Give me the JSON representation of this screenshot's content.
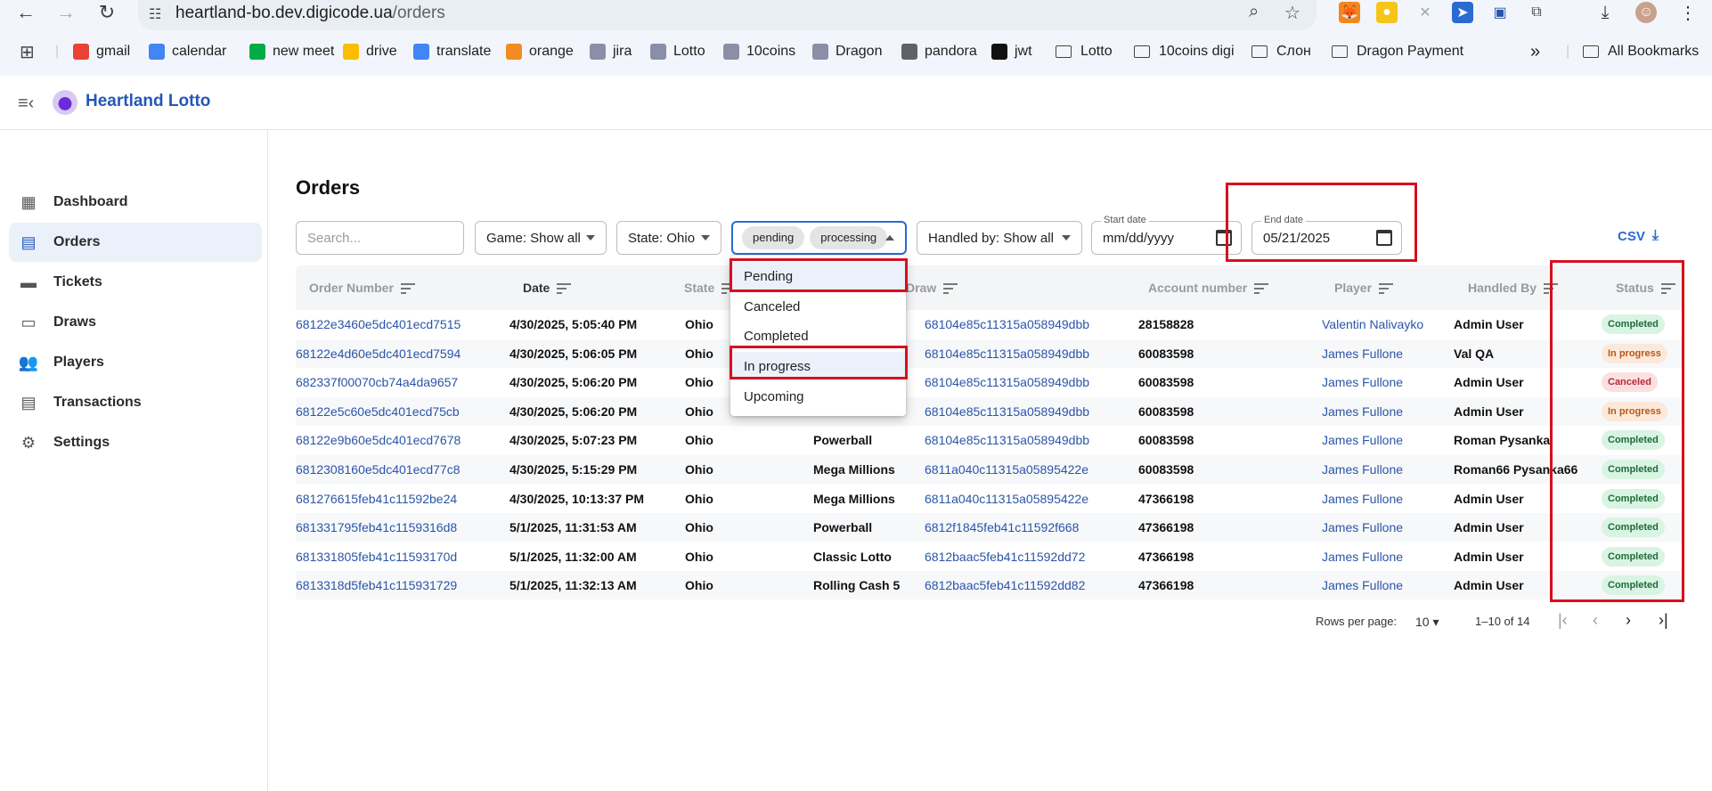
{
  "browser": {
    "url_host": "heartland-bo.dev.digicode.ua",
    "url_path": "/orders",
    "bookmarks": [
      {
        "label": "gmail",
        "icon": "gmail-icon",
        "color": "#ea4335"
      },
      {
        "label": "calendar",
        "icon": "calendar-icon",
        "color": "#4285f4"
      },
      {
        "label": "new meet",
        "icon": "meet-icon",
        "color": "#00ac47"
      },
      {
        "label": "drive",
        "icon": "drive-icon",
        "color": "#fbbc04"
      },
      {
        "label": "translate",
        "icon": "translate-icon",
        "color": "#4285f4"
      },
      {
        "label": "orange",
        "icon": "orange-icon",
        "color": "#f28b24"
      },
      {
        "label": "jira",
        "icon": "jira-icon",
        "color": "#8a8fa8"
      },
      {
        "label": "Lotto",
        "icon": "lotto-icon",
        "color": "#8a8fa8"
      },
      {
        "label": "10coins",
        "icon": "coins-icon",
        "color": "#8a8fa8"
      },
      {
        "label": "Dragon",
        "icon": "dragon-icon",
        "color": "#8a8fa8"
      },
      {
        "label": "pandora",
        "icon": "lock-icon",
        "color": "#5f6368"
      },
      {
        "label": "jwt",
        "icon": "jwt-icon",
        "color": "#111111"
      }
    ],
    "bookmark_folders": [
      "Lotto",
      "10coins digi",
      "Слон",
      "Dragon Payment"
    ],
    "all_bookmarks": "All Bookmarks",
    "more": "»"
  },
  "app": {
    "title": "Heartland Lotto"
  },
  "sidebar": {
    "items": [
      {
        "label": "Dashboard",
        "icon": "dashboard-icon",
        "glyph": "▦"
      },
      {
        "label": "Orders",
        "icon": "orders-icon",
        "glyph": "▤"
      },
      {
        "label": "Tickets",
        "icon": "tickets-icon",
        "glyph": "▬"
      },
      {
        "label": "Draws",
        "icon": "draws-icon",
        "glyph": "▭"
      },
      {
        "label": "Players",
        "icon": "players-icon",
        "glyph": "👥"
      },
      {
        "label": "Transactions",
        "icon": "transactions-icon",
        "glyph": "▤"
      },
      {
        "label": "Settings",
        "icon": "gear-icon",
        "glyph": "⚙"
      }
    ]
  },
  "page": {
    "title": "Orders",
    "filters": {
      "search_placeholder": "Search...",
      "game": "Game: Show all",
      "state": "State: Ohio",
      "status_chips": [
        "pending",
        "processing"
      ],
      "handled_by": "Handled by: Show all",
      "start_label": "Start date",
      "start_value": "mm/dd/yyyy",
      "end_label": "End date",
      "end_value": "05/21/2025"
    },
    "csv": "CSV",
    "status_options": [
      "Pending",
      "Canceled",
      "Completed",
      "In progress",
      "Upcoming"
    ],
    "columns": [
      "Order Number",
      "Date",
      "State",
      "Draw",
      "Account number",
      "Player",
      "Handled By",
      "Status"
    ],
    "rows": [
      {
        "order": "68122e3460e5dc401ecd7515",
        "date": "4/30/2025, 5:05:40 PM",
        "state": "Ohio",
        "game": "",
        "draw": "68104e85c11315a058949dbb",
        "account": "28158828",
        "player": "Valentin Nalivayko",
        "handled": "Admin User",
        "status": "Completed",
        "kind": "completed"
      },
      {
        "order": "68122e4d60e5dc401ecd7594",
        "date": "4/30/2025, 5:06:05 PM",
        "state": "Ohio",
        "game": "",
        "draw": "68104e85c11315a058949dbb",
        "account": "60083598",
        "player": "James Fullone",
        "handled": "Val QA",
        "status": "In progress",
        "kind": "progress"
      },
      {
        "order": "682337f00070cb74a4da9657",
        "date": "4/30/2025, 5:06:20 PM",
        "state": "Ohio",
        "game": "",
        "draw": "68104e85c11315a058949dbb",
        "account": "60083598",
        "player": "James Fullone",
        "handled": "Admin User",
        "status": "Canceled",
        "kind": "canceled"
      },
      {
        "order": "68122e5c60e5dc401ecd75cb",
        "date": "4/30/2025, 5:06:20 PM",
        "state": "Ohio",
        "game": "",
        "draw": "68104e85c11315a058949dbb",
        "account": "60083598",
        "player": "James Fullone",
        "handled": "Admin User",
        "status": "In progress",
        "kind": "progress"
      },
      {
        "order": "68122e9b60e5dc401ecd7678",
        "date": "4/30/2025, 5:07:23 PM",
        "state": "Ohio",
        "game": "Powerball",
        "draw": "68104e85c11315a058949dbb",
        "account": "60083598",
        "player": "James Fullone",
        "handled": "Roman Pysanka",
        "status": "Completed",
        "kind": "completed"
      },
      {
        "order": "6812308160e5dc401ecd77c8",
        "date": "4/30/2025, 5:15:29 PM",
        "state": "Ohio",
        "game": "Mega Millions",
        "draw": "6811a040c11315a05895422e",
        "account": "60083598",
        "player": "James Fullone",
        "handled": "Roman66 Pysanka66",
        "status": "Completed",
        "kind": "completed"
      },
      {
        "order": "681276615feb41c11592be24",
        "date": "4/30/2025, 10:13:37 PM",
        "state": "Ohio",
        "game": "Mega Millions",
        "draw": "6811a040c11315a05895422e",
        "account": "47366198",
        "player": "James Fullone",
        "handled": "Admin User",
        "status": "Completed",
        "kind": "completed"
      },
      {
        "order": "681331795feb41c1159316d8",
        "date": "5/1/2025, 11:31:53 AM",
        "state": "Ohio",
        "game": "Powerball",
        "draw": "6812f1845feb41c11592f668",
        "account": "47366198",
        "player": "James Fullone",
        "handled": "Admin User",
        "status": "Completed",
        "kind": "completed"
      },
      {
        "order": "681331805feb41c11593170d",
        "date": "5/1/2025, 11:32:00 AM",
        "state": "Ohio",
        "game": "Classic Lotto",
        "draw": "6812baac5feb41c11592dd72",
        "account": "47366198",
        "player": "James Fullone",
        "handled": "Admin User",
        "status": "Completed",
        "kind": "completed"
      },
      {
        "order": "6813318d5feb41c115931729",
        "date": "5/1/2025, 11:32:13 AM",
        "state": "Ohio",
        "game": "Rolling Cash 5",
        "draw": "6812baac5feb41c11592dd82",
        "account": "47366198",
        "player": "James Fullone",
        "handled": "Admin User",
        "status": "Completed",
        "kind": "completed"
      }
    ],
    "pagination": {
      "rows_label": "Rows per page:",
      "rows_value": "10",
      "range": "1–10 of 14"
    }
  }
}
